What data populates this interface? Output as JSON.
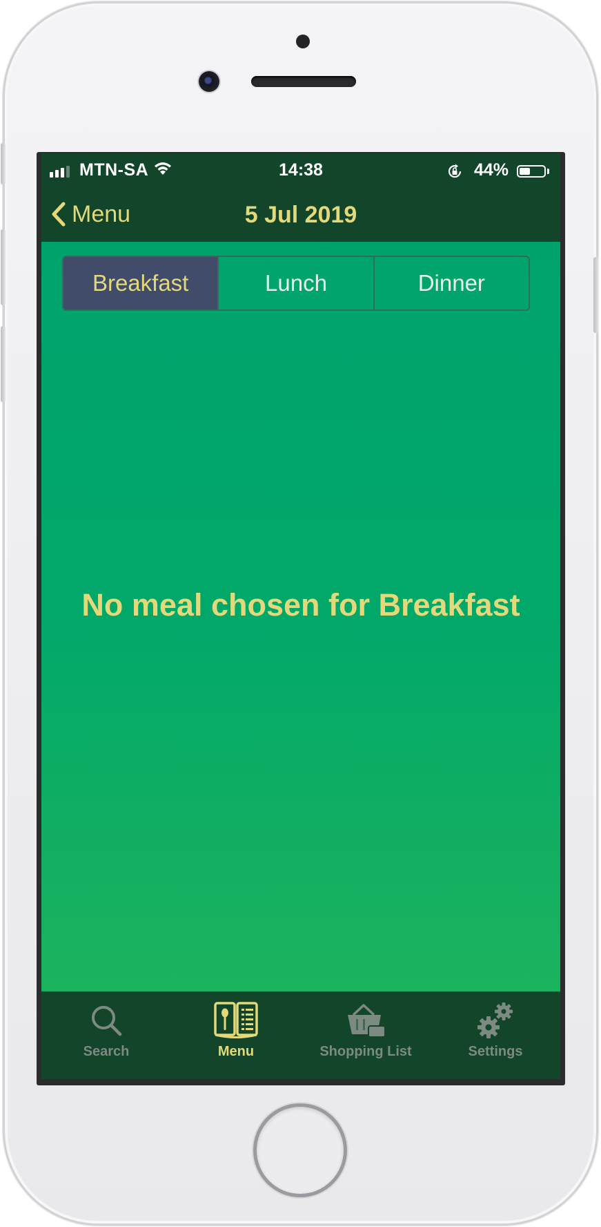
{
  "status_bar": {
    "carrier": "MTN-SA",
    "time": "14:38",
    "battery_percent": "44%",
    "battery_level": 0.44,
    "signal_bars": 4,
    "signal_bars_active": 3
  },
  "nav": {
    "back_label": "Menu",
    "title": "5 Jul 2019"
  },
  "segments": {
    "items": [
      {
        "label": "Breakfast",
        "selected": true
      },
      {
        "label": "Lunch",
        "selected": false
      },
      {
        "label": "Dinner",
        "selected": false
      }
    ]
  },
  "content": {
    "empty_message": "No meal chosen for Breakfast"
  },
  "tab_bar": {
    "items": [
      {
        "label": "Search",
        "icon": "search-icon",
        "active": false
      },
      {
        "label": "Menu",
        "icon": "menu-book-icon",
        "active": true
      },
      {
        "label": "Shopping List",
        "icon": "shopping-basket-icon",
        "active": false
      },
      {
        "label": "Settings",
        "icon": "gears-icon",
        "active": false
      }
    ]
  },
  "colors": {
    "accent": "#e3d97a",
    "nav_background": "#12452a",
    "content_green": "#00a36c",
    "selected_segment": "#414b6a",
    "inactive_tab": "#7d8a82"
  }
}
